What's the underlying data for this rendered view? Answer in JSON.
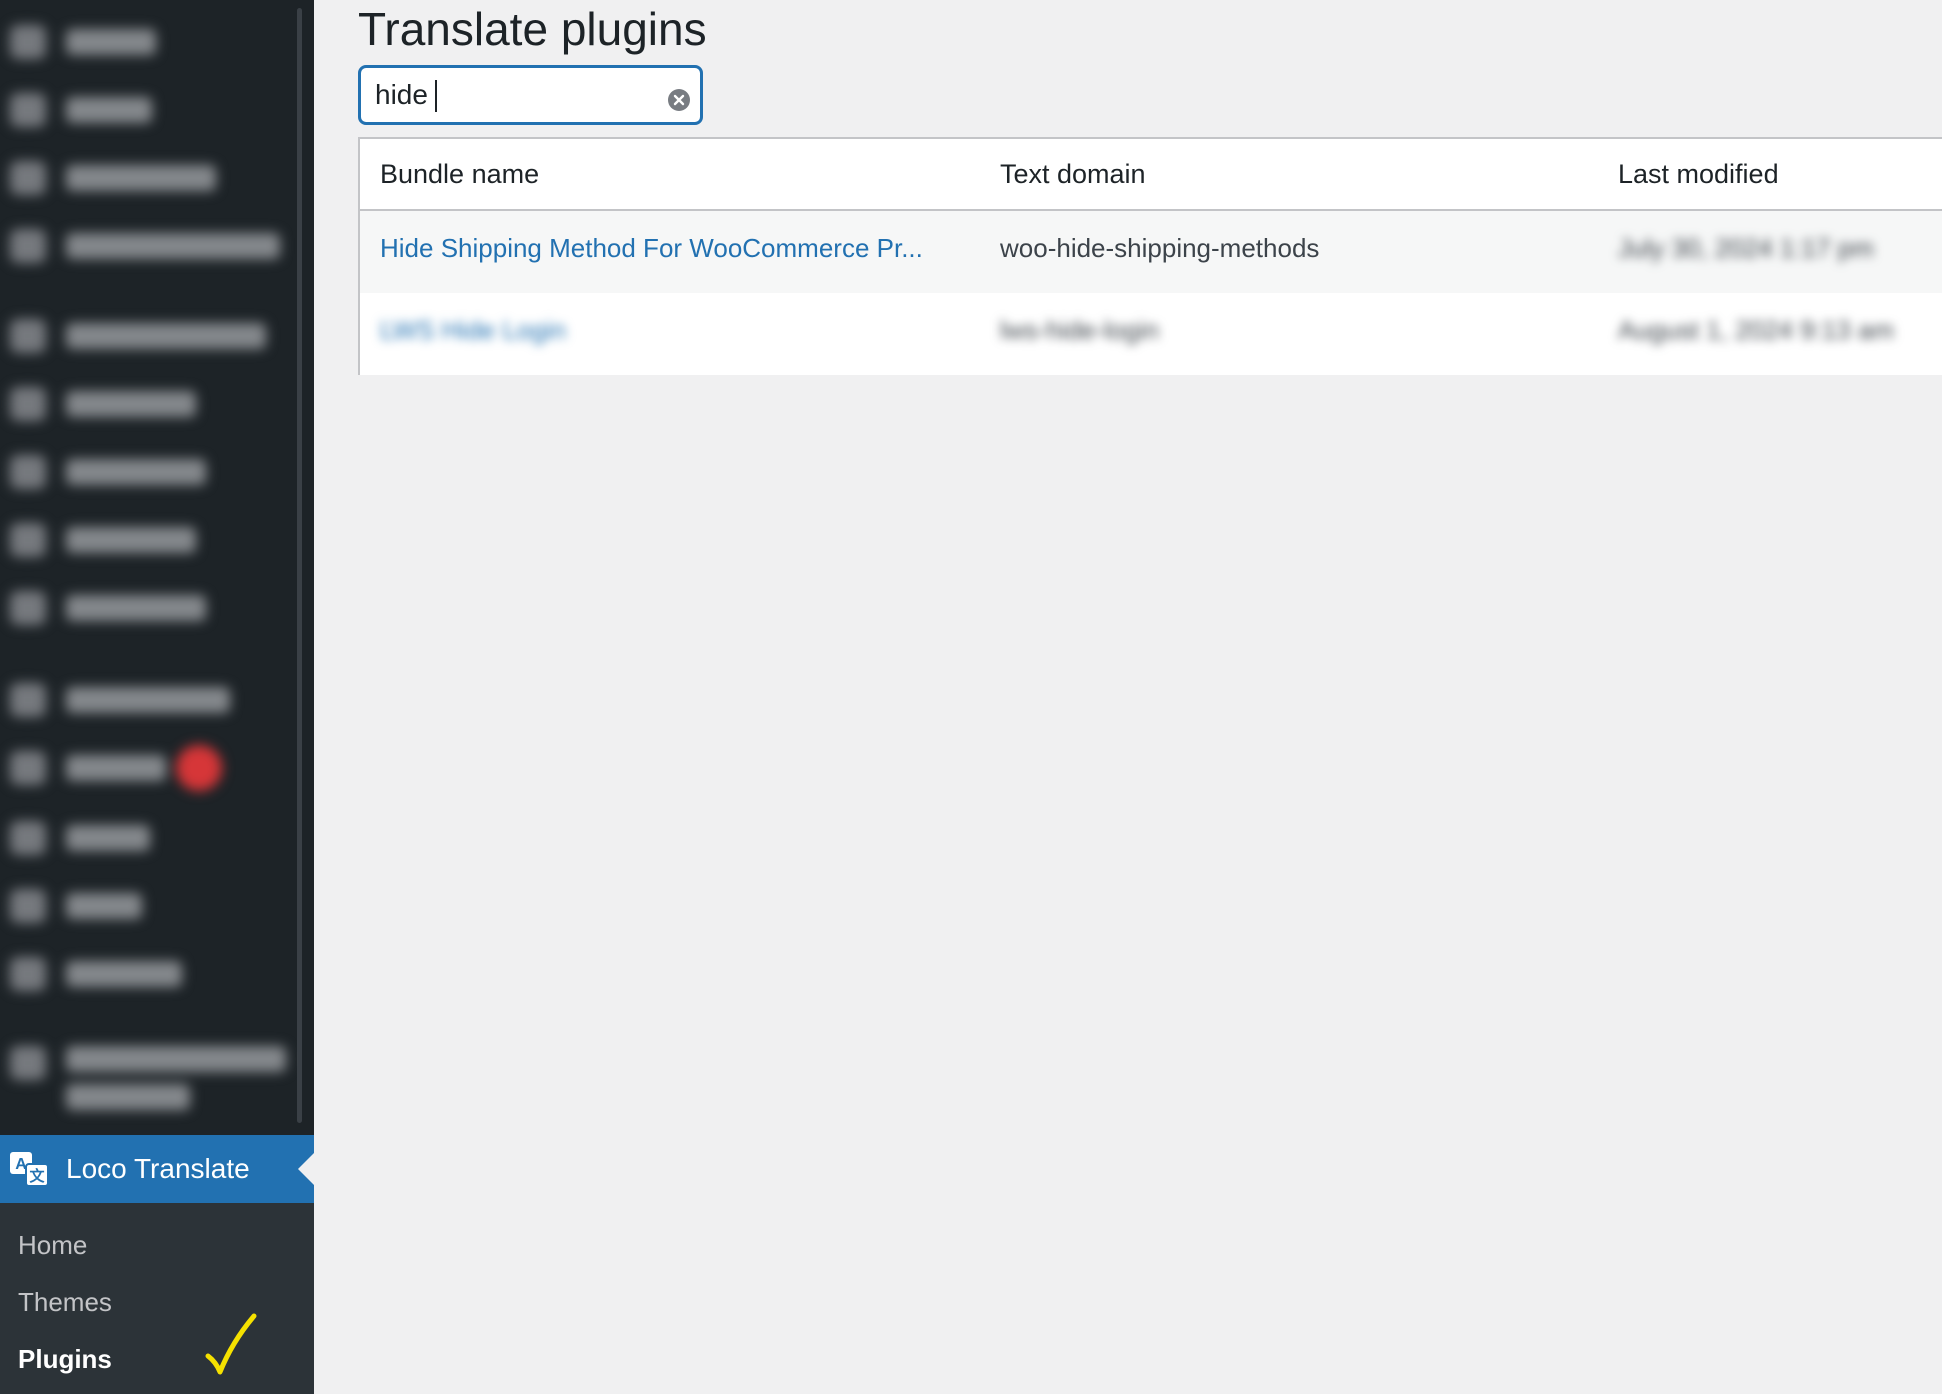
{
  "sidebar": {
    "blurred_items": [
      {
        "label": "Media"
      },
      {
        "label": "Pages"
      },
      {
        "label": "Comments"
      },
      {
        "label": "Elementor Plugins"
      },
      {
        "label": "WooCommerce"
      },
      {
        "label": "Products"
      },
      {
        "label": "Payments"
      },
      {
        "label": "Analytics"
      },
      {
        "label": "Marketing"
      },
      {
        "label": "Appearance"
      },
      {
        "label": "Plugins"
      },
      {
        "label": "Users"
      },
      {
        "label": "Tools"
      },
      {
        "label": "Settings"
      },
      {
        "label": "Freemius Debug"
      }
    ],
    "active_menu": {
      "label": "Loco Translate",
      "icon": "translate-icon"
    },
    "submenu": [
      {
        "label": "Home"
      },
      {
        "label": "Themes"
      },
      {
        "label": "Plugins",
        "current": true
      }
    ],
    "colors": {
      "background": "#1d2327",
      "active": "#2271b1",
      "submenu_bg": "#2c3338"
    }
  },
  "main": {
    "title": "Translate plugins",
    "search": {
      "value": "hide",
      "clear_icon": "clear-icon"
    },
    "table": {
      "columns": [
        "Bundle name",
        "Text domain",
        "Last modified"
      ],
      "rows": [
        {
          "bundle_name": "Hide Shipping Method For WooCommerce Pr...",
          "text_domain": "woo-hide-shipping-methods",
          "last_modified": "July 30, 2024 1:17 pm"
        },
        {
          "bundle_name": "LWS Hide Login",
          "text_domain": "lws-hide-login",
          "last_modified": "August 1, 2024 9:13 am"
        }
      ]
    }
  },
  "annotation": {
    "checkmark_color": "#f5e100"
  }
}
